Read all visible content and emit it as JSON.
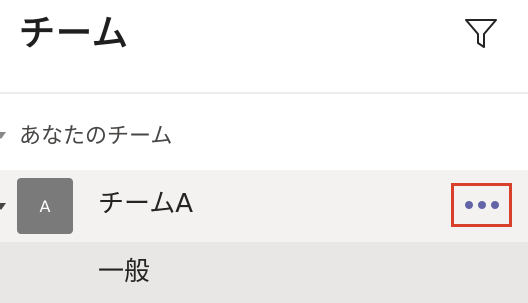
{
  "header": {
    "title": "チーム",
    "filter_icon": "filter-funnel-icon"
  },
  "section": {
    "label": "あなたのチーム",
    "collapse_icon": "caret-down-icon"
  },
  "teams": [
    {
      "avatar_letter": "A",
      "name": "チームA",
      "more_icon": "more-options-icon",
      "channels": [
        {
          "name": "一般"
        }
      ]
    }
  ],
  "colors": {
    "accent": "#6264a7",
    "highlight_box": "#d9402b",
    "avatar_bg": "#7a7a7a",
    "team_row_bg": "#f3f2f1",
    "channel_row_bg": "#e8e7e6"
  }
}
